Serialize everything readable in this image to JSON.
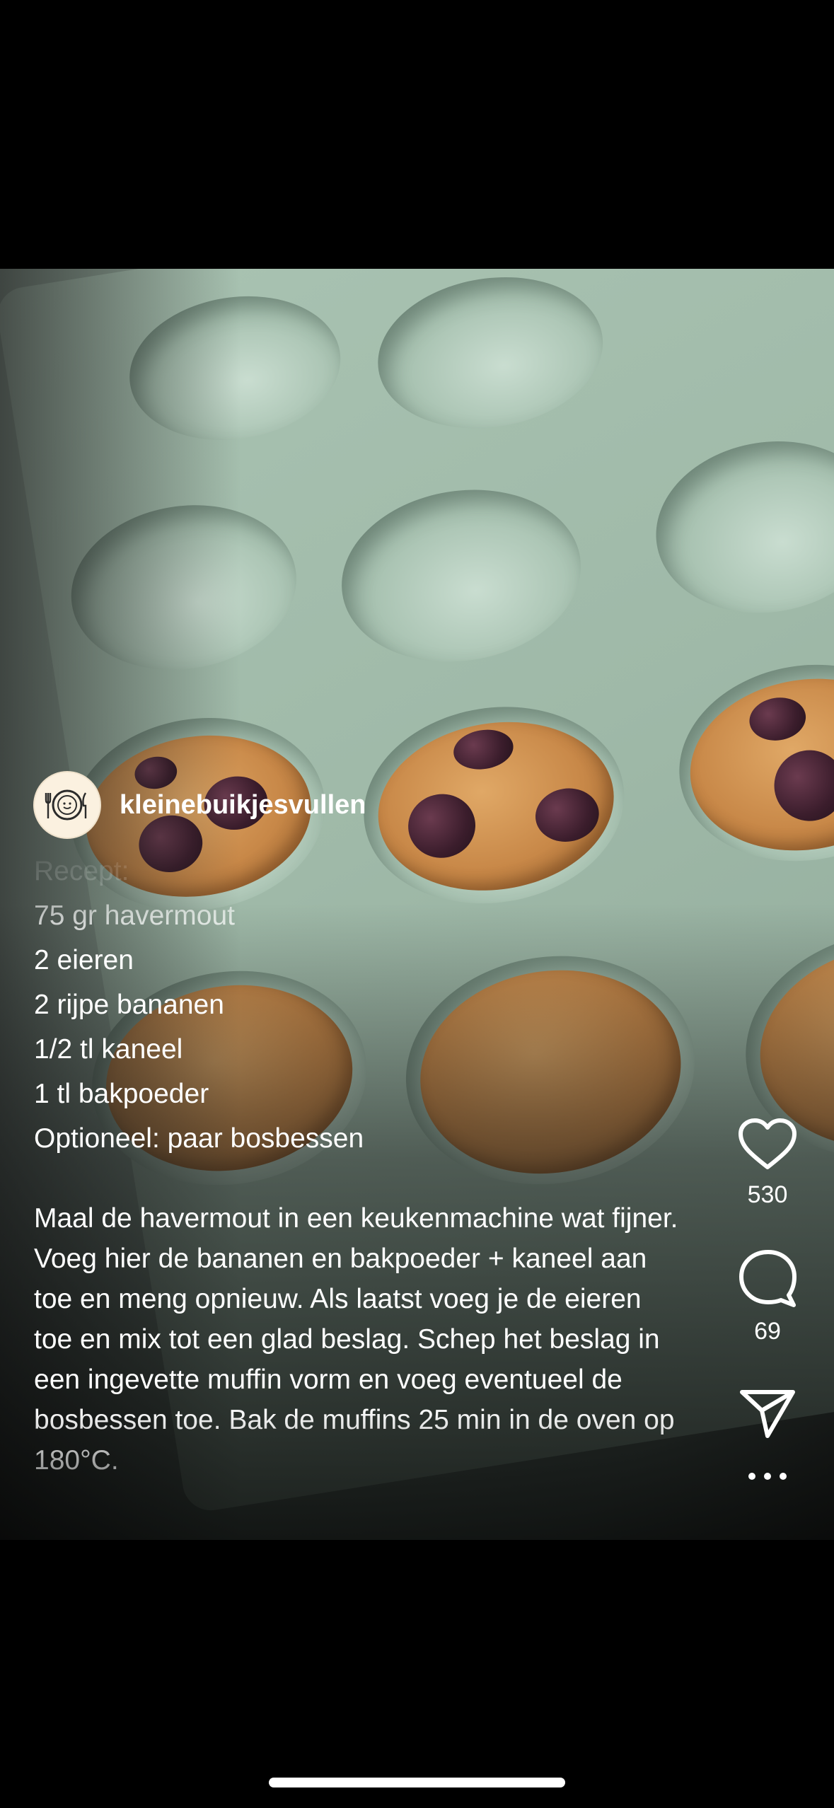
{
  "post": {
    "username": "kleinebuikjesvullen",
    "avatar_icon": "plate-cutlery-icon"
  },
  "caption": {
    "heading": "Recept:",
    "ingredients": [
      "75 gr havermout",
      "2 eieren",
      "2 rijpe bananen",
      "1/2 tl kaneel",
      "1 tl bakpoeder",
      "Optioneel: paar bosbessen"
    ],
    "instructions_1": "Maal de havermout in een keukenmachine wat fijner. Voeg hier de bananen en bakpoeder + kaneel aan toe en meng opnieuw. Als laatst voeg je de eieren toe en mix tot een glad beslag. Schep het beslag in een ingevette muffin vorm en voeg eventueel de bosbessen toe.",
    "instructions_2": "Bak de muffins 25 min in de oven op 180°C."
  },
  "actions": {
    "likes": "530",
    "comments": "69",
    "like_icon": "heart-icon",
    "comment_icon": "comment-bubble-icon",
    "share_icon": "send-icon",
    "more_icon": "more-icon"
  }
}
